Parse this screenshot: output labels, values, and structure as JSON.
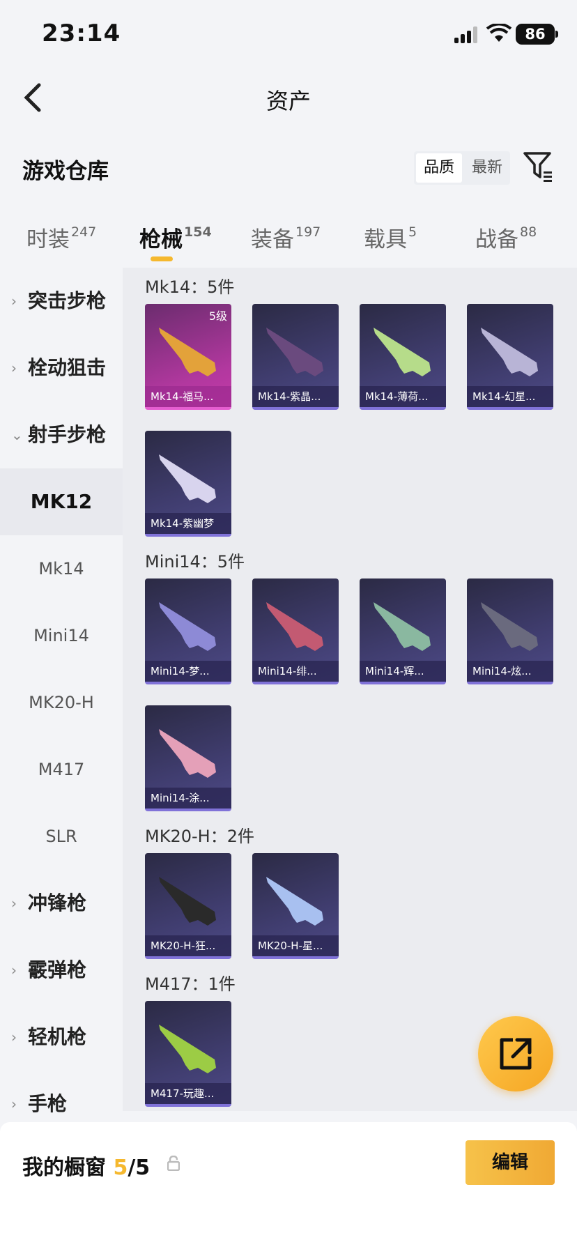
{
  "status": {
    "time": "23:14",
    "battery": "86"
  },
  "nav": {
    "title": "资产"
  },
  "section": {
    "title": "游戏仓库",
    "sort_quality": "品质",
    "sort_newest": "最新"
  },
  "tabs": [
    {
      "label": "时装",
      "count": "247"
    },
    {
      "label": "枪械",
      "count": "154"
    },
    {
      "label": "装备",
      "count": "197"
    },
    {
      "label": "载具",
      "count": "5"
    },
    {
      "label": "战备",
      "count": "88"
    }
  ],
  "sidebar": {
    "cats": [
      "突击步枪",
      "栓动狙击",
      "射手步枪"
    ],
    "selected": "MK12",
    "subs": [
      "Mk14",
      "Mini14",
      "MK20-H",
      "M417",
      "SLR"
    ],
    "more": [
      "冲锋枪",
      "霰弹枪",
      "轻机枪",
      "手枪"
    ]
  },
  "groups": [
    {
      "title": "Mk14：5件",
      "items": [
        {
          "name": "Mk14-福马...",
          "level": "5级"
        },
        {
          "name": "Mk14-紫晶..."
        },
        {
          "name": "Mk14-薄荷..."
        },
        {
          "name": "Mk14-幻星..."
        },
        {
          "name": "Mk14-紫幽梦"
        }
      ]
    },
    {
      "title": "Mini14：5件",
      "items": [
        {
          "name": "Mini14-梦..."
        },
        {
          "name": "Mini14-绯..."
        },
        {
          "name": "Mini14-辉..."
        },
        {
          "name": "Mini14-炫..."
        },
        {
          "name": "Mini14-涂..."
        }
      ]
    },
    {
      "title": "MK20-H：2件",
      "items": [
        {
          "name": "MK20-H-狂..."
        },
        {
          "name": "MK20-H-星..."
        }
      ]
    },
    {
      "title": "M417：1件",
      "items": [
        {
          "name": "M417-玩趣..."
        }
      ]
    }
  ],
  "bottom": {
    "label": "我的橱窗",
    "count": "5",
    "total": "/5",
    "edit": "编辑"
  },
  "colors": {
    "accent": "#f5b82e",
    "card": "#403d6f",
    "gold_card": "#b2389f"
  }
}
